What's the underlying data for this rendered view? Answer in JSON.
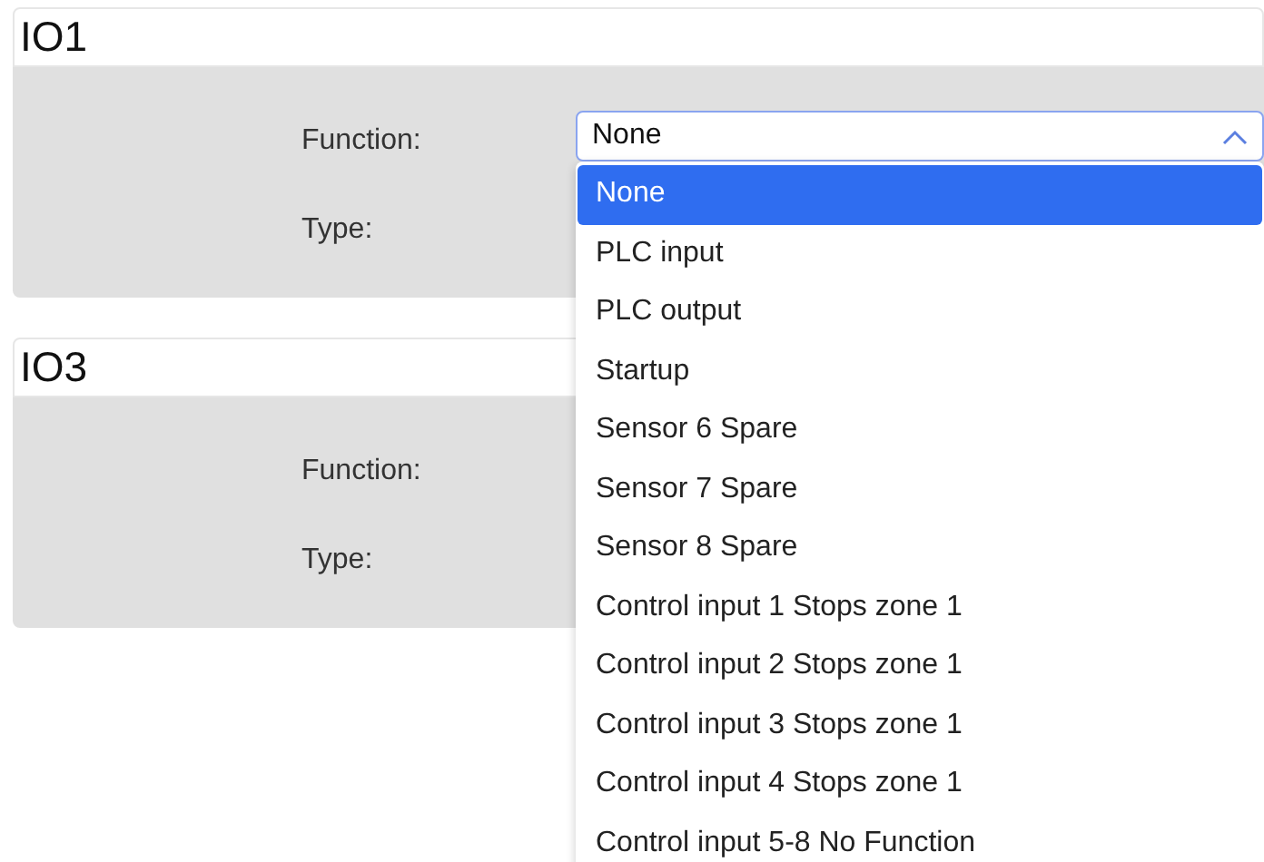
{
  "sections": [
    {
      "title": "IO1",
      "fields": [
        {
          "label": "Function:"
        },
        {
          "label": "Type:"
        }
      ],
      "select": {
        "value": "None",
        "expanded": true
      }
    },
    {
      "title": "IO3",
      "fields": [
        {
          "label": "Function:"
        },
        {
          "label": "Type:"
        }
      ]
    }
  ],
  "dropdown": {
    "options": [
      {
        "label": "None",
        "selected": true
      },
      {
        "label": "PLC input",
        "selected": false
      },
      {
        "label": "PLC output",
        "selected": false
      },
      {
        "label": "Startup",
        "selected": false
      },
      {
        "label": "Sensor 6 Spare",
        "selected": false
      },
      {
        "label": "Sensor 7 Spare",
        "selected": false
      },
      {
        "label": "Sensor 8 Spare",
        "selected": false
      },
      {
        "label": "Control input 1 Stops zone 1",
        "selected": false
      },
      {
        "label": "Control input 2 Stops zone 1",
        "selected": false
      },
      {
        "label": "Control input 3 Stops zone 1",
        "selected": false
      },
      {
        "label": "Control input 4 Stops zone 1",
        "selected": false
      },
      {
        "label": "Control input 5-8 No Function",
        "selected": false
      }
    ]
  }
}
